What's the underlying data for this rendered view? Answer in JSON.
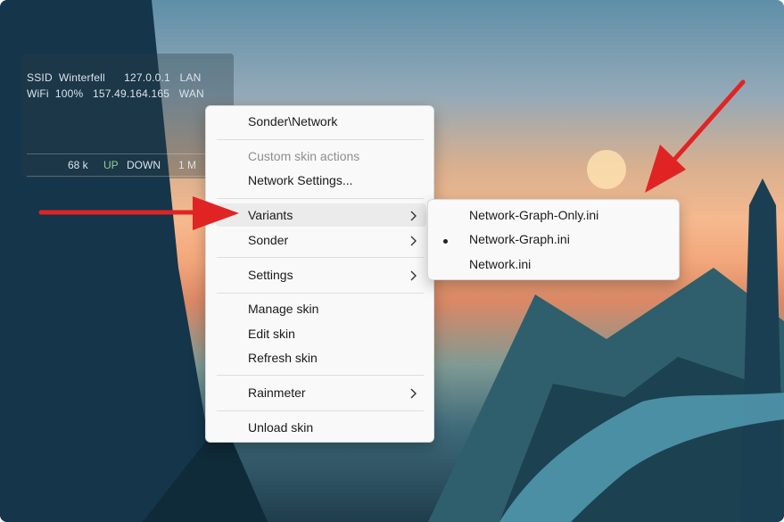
{
  "widget": {
    "row1": "SSID  Winterfell      127.0.0.1   LAN",
    "row2": "WiFi  100%   157.49.164.165   WAN",
    "download": "68 k",
    "up_label": "UP",
    "down_label": "DOWN",
    "upload": "1 M"
  },
  "menu": {
    "skin_name": "Sonder\\Network",
    "custom_actions": "Custom skin actions",
    "network_settings": "Network Settings...",
    "variants": "Variants",
    "sonder": "Sonder",
    "settings": "Settings",
    "manage_skin": "Manage skin",
    "edit_skin": "Edit skin",
    "refresh_skin": "Refresh skin",
    "rainmeter": "Rainmeter",
    "unload_skin": "Unload skin"
  },
  "submenu": {
    "items": [
      {
        "label": "Network-Graph-Only.ini",
        "selected": false
      },
      {
        "label": "Network-Graph.ini",
        "selected": true
      },
      {
        "label": "Network.ini",
        "selected": false
      }
    ]
  },
  "colors": {
    "annotation_arrow": "#e02424",
    "up_accent": "#8fd18f"
  },
  "icons": [
    "chevron-right-icon",
    "bullet-icon",
    "annotation-arrow-icon"
  ]
}
